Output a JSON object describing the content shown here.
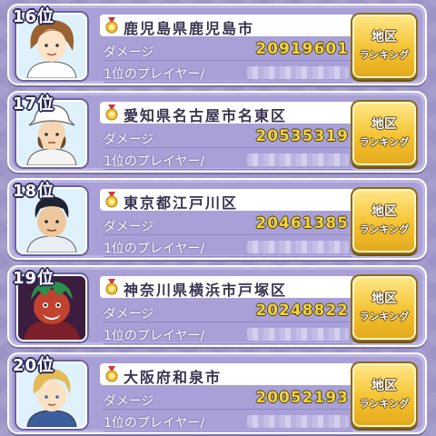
{
  "labels": {
    "damage": "ダメージ",
    "first_player": "1位のプレイヤー/",
    "button_top": "地区",
    "button_bottom": "ランキング"
  },
  "rows": [
    {
      "rank": "16位",
      "region": "鹿児島県鹿児島市",
      "damage": "20919601",
      "avatar": "brown-hair-avatar"
    },
    {
      "rank": "17位",
      "region": "愛知県名古屋市名東区",
      "damage": "20535319",
      "avatar": "white-hat-avatar"
    },
    {
      "rank": "18位",
      "region": "東京都江戸川区",
      "damage": "20461385",
      "avatar": "black-hair-avatar"
    },
    {
      "rank": "19位",
      "region": "神奈川県横浜市戸塚区",
      "damage": "20248822",
      "avatar": "red-monster-avatar"
    },
    {
      "rank": "20位",
      "region": "大阪府和泉市",
      "damage": "20052193",
      "avatar": "blonde-hair-avatar"
    }
  ],
  "colors": {
    "background": "#9c93c6",
    "card": "#a8a0d6",
    "damage_value": "#f3d438",
    "button": "#f4c231"
  }
}
